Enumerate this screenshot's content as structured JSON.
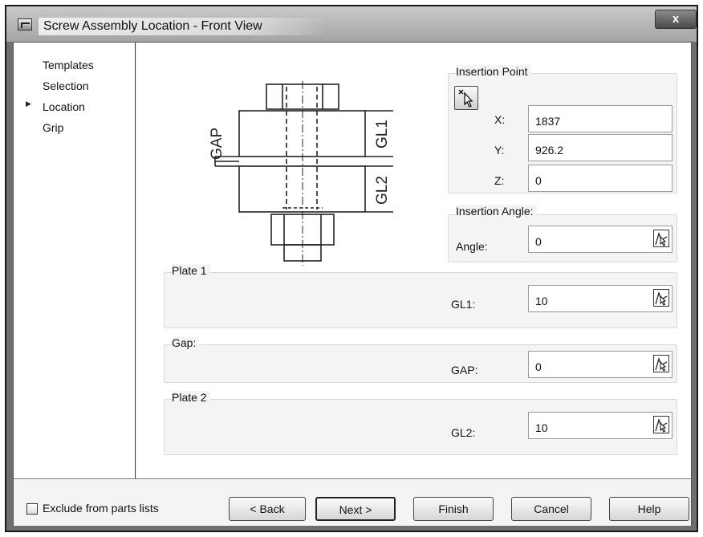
{
  "window": {
    "title": "Screw Assembly Location - Front View",
    "close_label": "x"
  },
  "nav": {
    "items": [
      {
        "label": "Templates"
      },
      {
        "label": "Selection"
      },
      {
        "label": "Location",
        "selected": true
      },
      {
        "label": "Grip"
      }
    ]
  },
  "diagram": {
    "gap_label": "GAP",
    "gl1_label": "GL1",
    "gl2_label": "GL2"
  },
  "insertion_point": {
    "title": "Insertion Point",
    "x_label": "X:",
    "x_value": "1837",
    "y_label": "Y:",
    "y_value": "926.2",
    "z_label": "Z:",
    "z_value": "0"
  },
  "insertion_angle": {
    "title": "Insertion Angle:",
    "angle_label": "Angle:",
    "angle_value": "0"
  },
  "plate1": {
    "title": "Plate 1",
    "label": "GL1:",
    "value": "10"
  },
  "gap": {
    "title": "Gap:",
    "label": "GAP:",
    "value": "0"
  },
  "plate2": {
    "title": "Plate 2",
    "label": "GL2:",
    "value": "10"
  },
  "footer": {
    "exclude_label": "Exclude from parts lists",
    "exclude_checked": false,
    "back_label": "< Back",
    "next_label": "Next >",
    "finish_label": "Finish",
    "cancel_label": "Cancel",
    "help_label": "Help"
  }
}
